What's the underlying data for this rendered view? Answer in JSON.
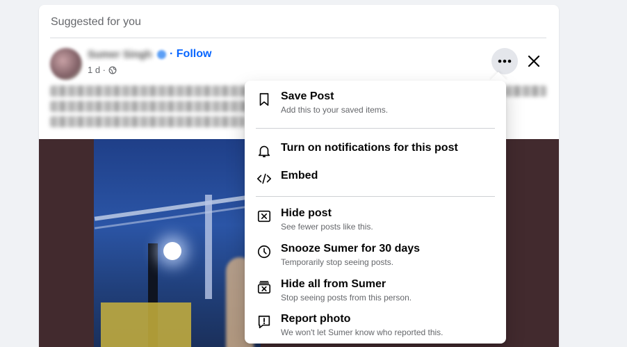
{
  "feed": {
    "section_title": "Suggested for you",
    "follow_label": "Follow",
    "post_age": "1 d ·"
  },
  "menu": {
    "items": [
      {
        "title": "Save Post",
        "subtitle": "Add this to your saved items.",
        "icon": "bookmark-icon"
      },
      {
        "title": "Turn on notifications for this post",
        "subtitle": "",
        "icon": "bell-icon"
      },
      {
        "title": "Embed",
        "subtitle": "",
        "icon": "code-icon"
      },
      {
        "title": "Hide post",
        "subtitle": "See fewer posts like this.",
        "icon": "hide-box-icon"
      },
      {
        "title": "Snooze Sumer for 30 days",
        "subtitle": "Temporarily stop seeing posts.",
        "icon": "clock-icon"
      },
      {
        "title": "Hide all from Sumer",
        "subtitle": "Stop seeing posts from this person.",
        "icon": "hide-all-icon"
      },
      {
        "title": "Report photo",
        "subtitle": "We won't let Sumer know who reported this.",
        "icon": "report-icon"
      }
    ]
  },
  "colors": {
    "accent": "#0866ff",
    "secondary_text": "#65676b",
    "button_bg": "#e4e6eb",
    "background": "#f0f2f5"
  }
}
